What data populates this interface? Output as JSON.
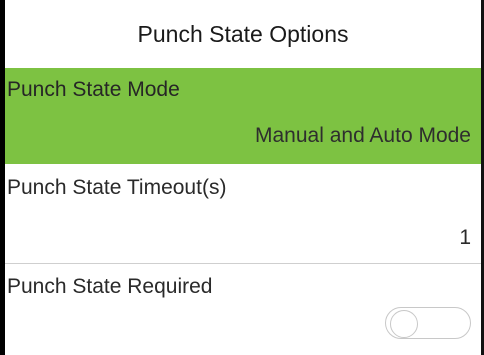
{
  "header": {
    "title": "Punch State Options"
  },
  "options": [
    {
      "label": "Punch State Mode",
      "value": "Manual and Auto Mode",
      "selected": true
    },
    {
      "label": "Punch State Timeout(s)",
      "value": "1",
      "selected": false
    },
    {
      "label": "Punch State Required",
      "toggle_state": "off",
      "selected": false
    }
  ],
  "colors": {
    "selected_background": "#7dc242",
    "divider": "#cfcfcf",
    "text": "#2a2a2a"
  }
}
